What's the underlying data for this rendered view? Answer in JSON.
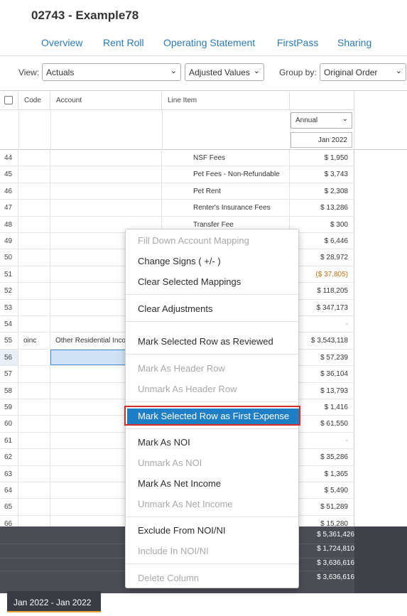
{
  "header": {
    "title": "02743 - Example78"
  },
  "tabs": [
    {
      "label": "Overview"
    },
    {
      "label": "Rent Roll"
    },
    {
      "label": "Operating Statement"
    },
    {
      "label": "FirstPass"
    },
    {
      "label": "Sharing"
    }
  ],
  "toolbar": {
    "view_label": "View:",
    "view_value": "Actuals",
    "values_value": "Adjusted Values",
    "groupby_label": "Group by:",
    "groupby_value": "Original Order"
  },
  "grid": {
    "columns": {
      "code": "Code",
      "account": "Account",
      "line_item": "Line Item"
    },
    "period_type": "Annual",
    "period_label": "Jan 2022",
    "rows": [
      {
        "num": "44",
        "code": "",
        "account": "",
        "line": "NSF Fees",
        "value": "$ 1,950"
      },
      {
        "num": "45",
        "code": "",
        "account": "",
        "line": "Pet Fees - Non-Refundable",
        "value": "$ 3,743"
      },
      {
        "num": "46",
        "code": "",
        "account": "",
        "line": "Pet Rent",
        "value": "$ 2,308"
      },
      {
        "num": "47",
        "code": "",
        "account": "",
        "line": "Renter's Insurance Fees",
        "value": "$ 13,286"
      },
      {
        "num": "48",
        "code": "",
        "account": "",
        "line": "Transfer Fee",
        "value": "$ 300"
      },
      {
        "num": "49",
        "code": "",
        "account": "",
        "line": "",
        "value": "$ 6,446"
      },
      {
        "num": "50",
        "code": "",
        "account": "",
        "line": "",
        "value": "$ 28,972"
      },
      {
        "num": "51",
        "code": "",
        "account": "",
        "line": "",
        "value": "($ 37,805)"
      },
      {
        "num": "52",
        "code": "",
        "account": "",
        "line": "",
        "value": "$ 118,205"
      },
      {
        "num": "53",
        "code": "",
        "account": "",
        "line": "",
        "value": "$ 347,173"
      },
      {
        "num": "54",
        "code": "",
        "account": "",
        "line": "",
        "value": "-"
      },
      {
        "num": "55",
        "code": "oinc",
        "account": "Other Residential Income",
        "line": "",
        "value": "$ 3,543,118"
      },
      {
        "num": "56",
        "code": "",
        "account": "",
        "line": "",
        "value": "$ 57,239"
      },
      {
        "num": "57",
        "code": "",
        "account": "",
        "line": "",
        "value": "$ 36,104"
      },
      {
        "num": "58",
        "code": "",
        "account": "",
        "line": "",
        "value": "$ 13,793"
      },
      {
        "num": "59",
        "code": "",
        "account": "",
        "line": "",
        "value": "$ 1,416"
      },
      {
        "num": "60",
        "code": "",
        "account": "",
        "line": "",
        "value": "$ 61,550"
      },
      {
        "num": "61",
        "code": "",
        "account": "",
        "line": "",
        "value": "-"
      },
      {
        "num": "62",
        "code": "",
        "account": "",
        "line": "",
        "value": "$ 35,286"
      },
      {
        "num": "63",
        "code": "",
        "account": "",
        "line": "",
        "value": "$ 1,365"
      },
      {
        "num": "64",
        "code": "",
        "account": "",
        "line": "",
        "value": "$ 5,490"
      },
      {
        "num": "65",
        "code": "",
        "account": "",
        "line": "",
        "value": "$ 51,289"
      },
      {
        "num": "66",
        "code": "",
        "account": "",
        "line": "",
        "value": "$ 15,280"
      }
    ]
  },
  "footer": {
    "totals": [
      "$ 5,361,426",
      "$ 1,724,810",
      "$ 3,636,616",
      "$ 3,636,616"
    ],
    "date_range": "Jan 2022 - Jan 2022"
  },
  "context_menu": {
    "items": [
      {
        "label": "Fill Down Account Mapping",
        "disabled": true
      },
      {
        "label": "Change Signs ( +/- )",
        "disabled": false
      },
      {
        "label": "Clear Selected Mappings",
        "disabled": false
      },
      {
        "label": "Clear Adjustments",
        "disabled": false
      },
      {
        "label": "Mark Selected Row as Reviewed",
        "disabled": false
      },
      {
        "label": "Mark As Header Row",
        "disabled": true
      },
      {
        "label": "Unmark As Header Row",
        "disabled": true
      },
      {
        "label": "Mark Selected Row as First Expense",
        "disabled": false,
        "highlighted": true
      },
      {
        "label": "Mark As NOI",
        "disabled": false
      },
      {
        "label": "Unmark As NOI",
        "disabled": true
      },
      {
        "label": "Mark As Net Income",
        "disabled": false
      },
      {
        "label": "Unmark As Net Income",
        "disabled": true
      },
      {
        "label": "Exclude From NOI/NI",
        "disabled": false
      },
      {
        "label": "Include In NOI/NI",
        "disabled": true
      },
      {
        "label": "Delete Column",
        "disabled": true
      }
    ]
  },
  "colors": {
    "accent": "#2a7ab8",
    "highlight": "#1e7fc6",
    "outline": "#d62b2b",
    "footer": "#4b4d55"
  }
}
